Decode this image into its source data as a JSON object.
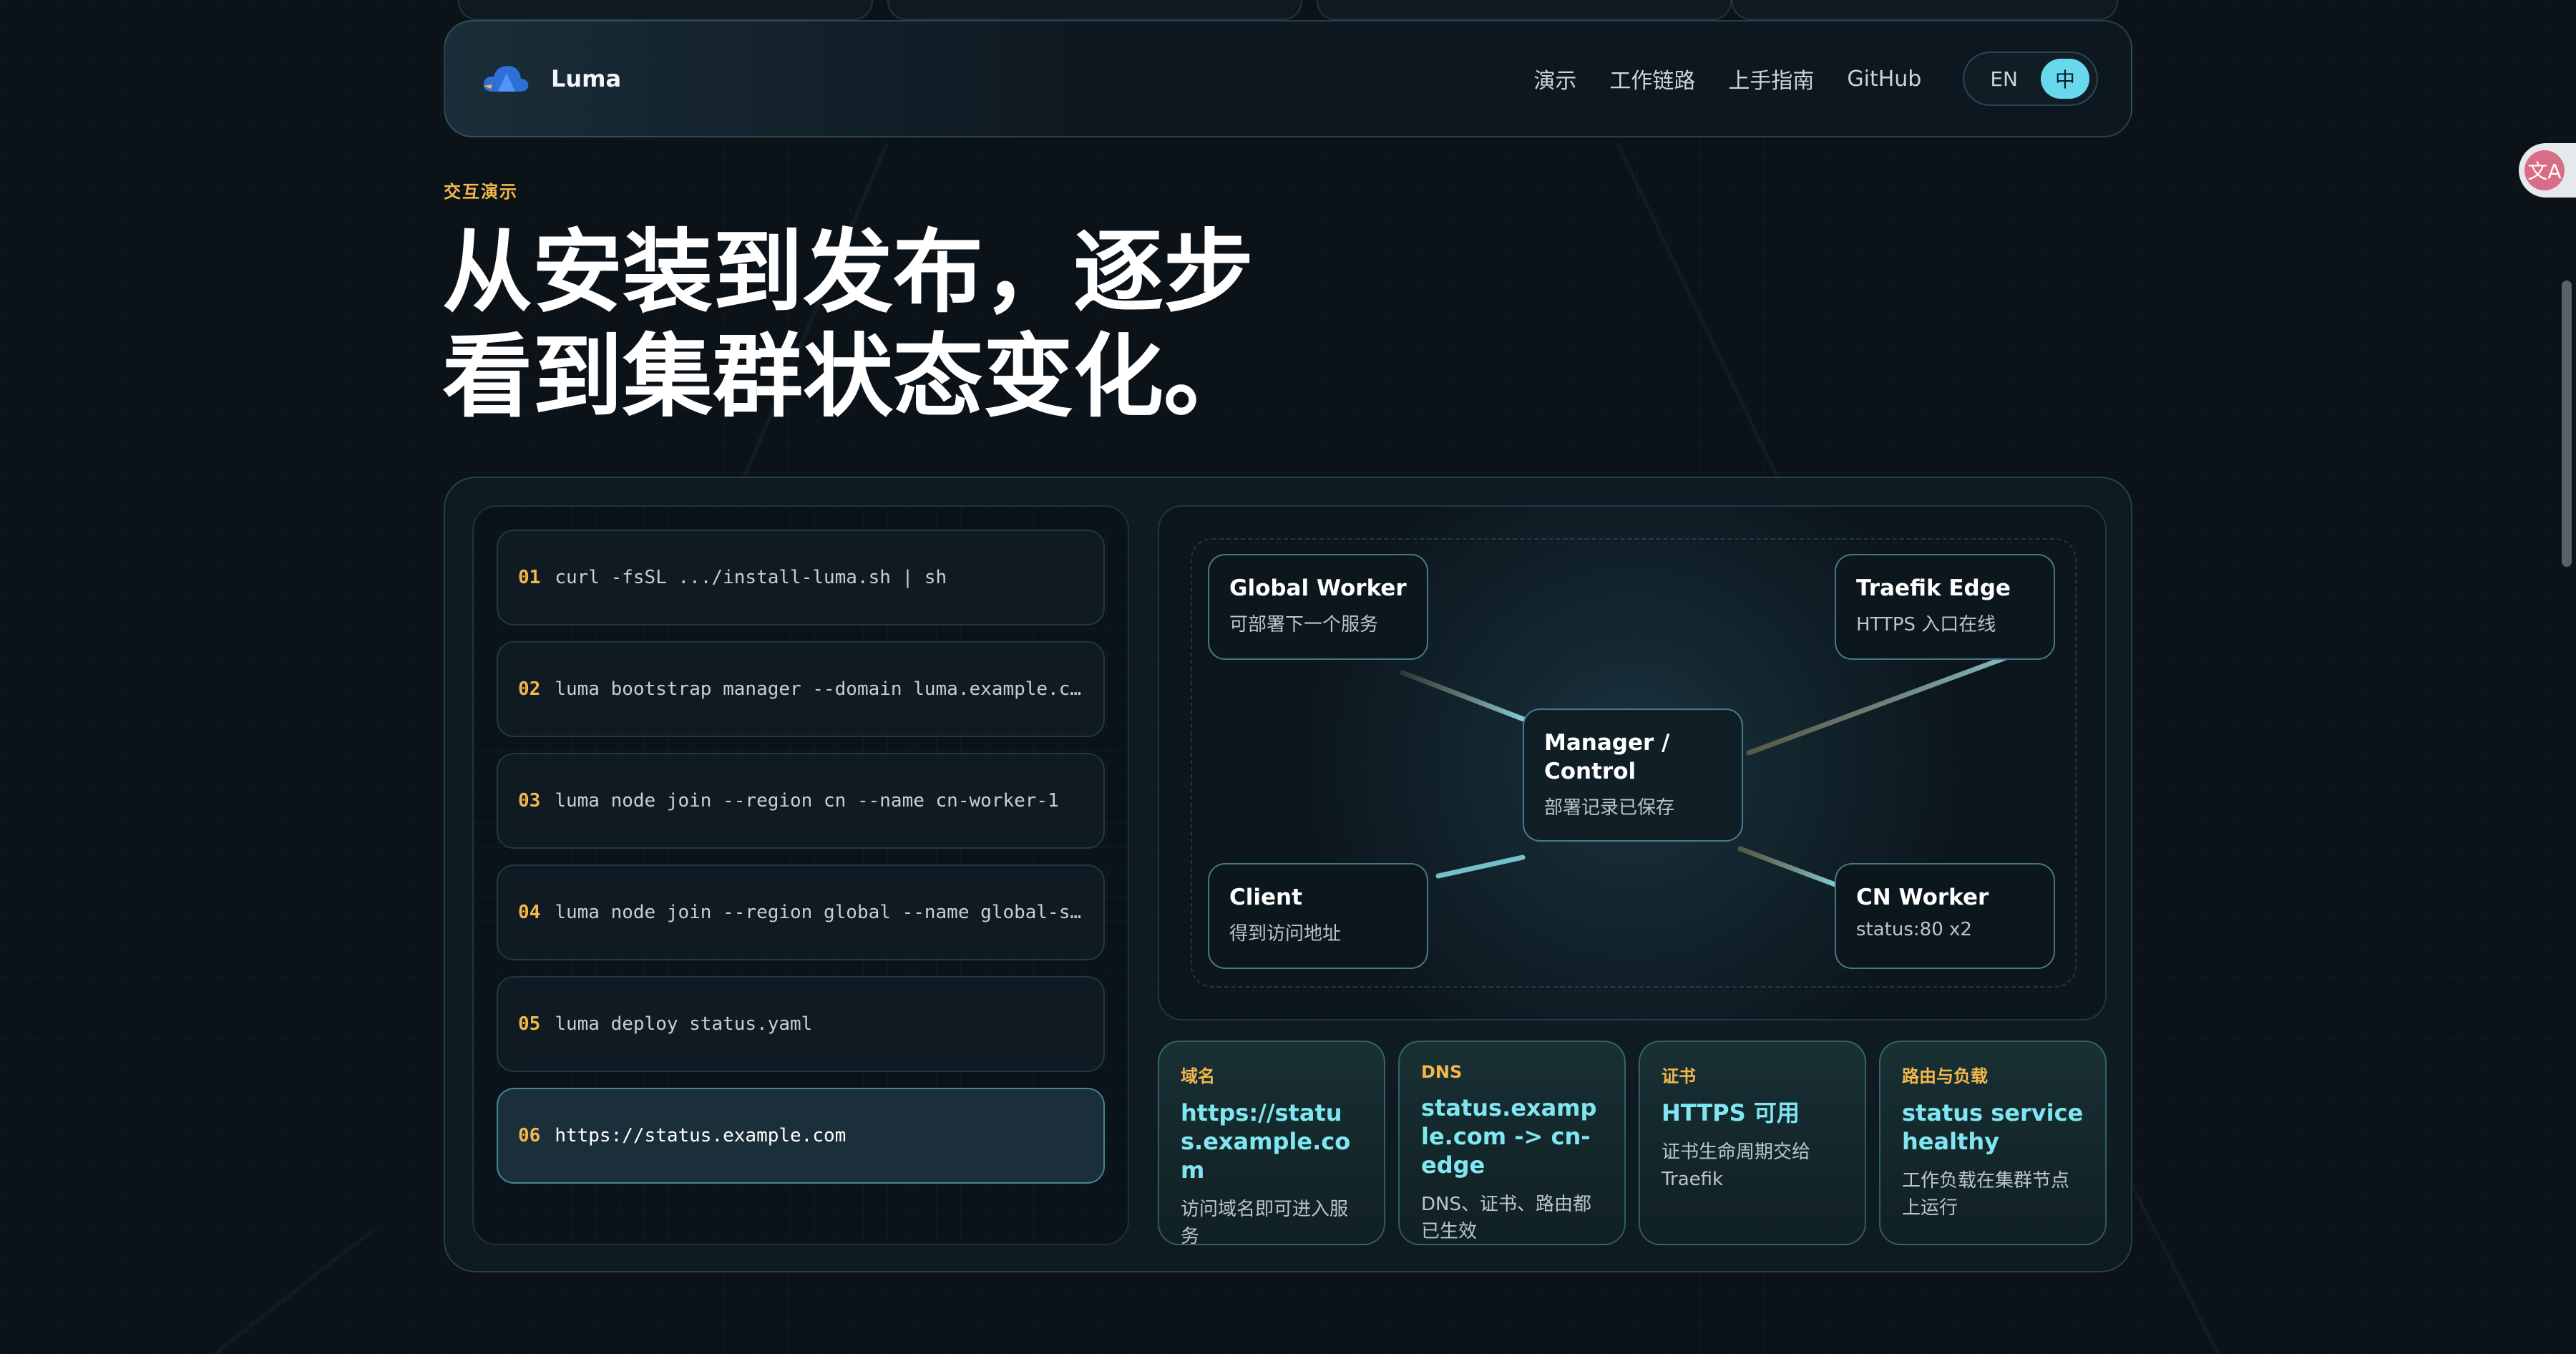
{
  "nav": {
    "brand": "Luma",
    "links": [
      "演示",
      "工作链路",
      "上手指南",
      "GitHub"
    ],
    "lang_en": "EN",
    "lang_zh": "中"
  },
  "eyebrow": "交互演示",
  "headline": {
    "line1": "从安装到发布，逐步",
    "line2": "看到集群状态变化。"
  },
  "steps": [
    {
      "num": "01",
      "cmd": "curl -fsSL .../install-luma.sh | sh"
    },
    {
      "num": "02",
      "cmd": "luma bootstrap manager --domain luma.example.com"
    },
    {
      "num": "03",
      "cmd": "luma node join --region cn --name cn-worker-1"
    },
    {
      "num": "04",
      "cmd": "luma node join --region global --name global-server"
    },
    {
      "num": "05",
      "cmd": "luma deploy status.yaml"
    },
    {
      "num": "06",
      "cmd": "https://status.example.com"
    }
  ],
  "active_step": "06",
  "diagram": {
    "global_worker": {
      "title": "Global Worker",
      "desc": "可部署下一个服务"
    },
    "traefik": {
      "title": "Traefik Edge",
      "desc": "HTTPS 入口在线"
    },
    "manager": {
      "title": "Manager / Control",
      "desc": "部署记录已保存"
    },
    "client": {
      "title": "Client",
      "desc": "得到访问地址"
    },
    "cn_worker": {
      "title": "CN Worker",
      "desc": "status:80 x2"
    }
  },
  "cards": [
    {
      "label": "域名",
      "value": "https://status.example.com",
      "desc": "访问域名即可进入服务"
    },
    {
      "label": "DNS",
      "value": "status.example.com -> cn-edge",
      "desc": "DNS、证书、路由都已生效"
    },
    {
      "label": "证书",
      "value": "HTTPS 可用",
      "desc": "证书生命周期交给 Traefik"
    },
    {
      "label": "路由与负载",
      "value": "status service healthy",
      "desc": "工作负载在集群节点上运行"
    }
  ],
  "colors": {
    "accent": "#69d7ec",
    "highlight": "#f2b84b",
    "value": "#7fe6f2",
    "background": "#0b1218"
  },
  "icons": {
    "brand": "cloud-logo-icon",
    "side": "translate-icon"
  },
  "side_badge_glyph": "文A"
}
